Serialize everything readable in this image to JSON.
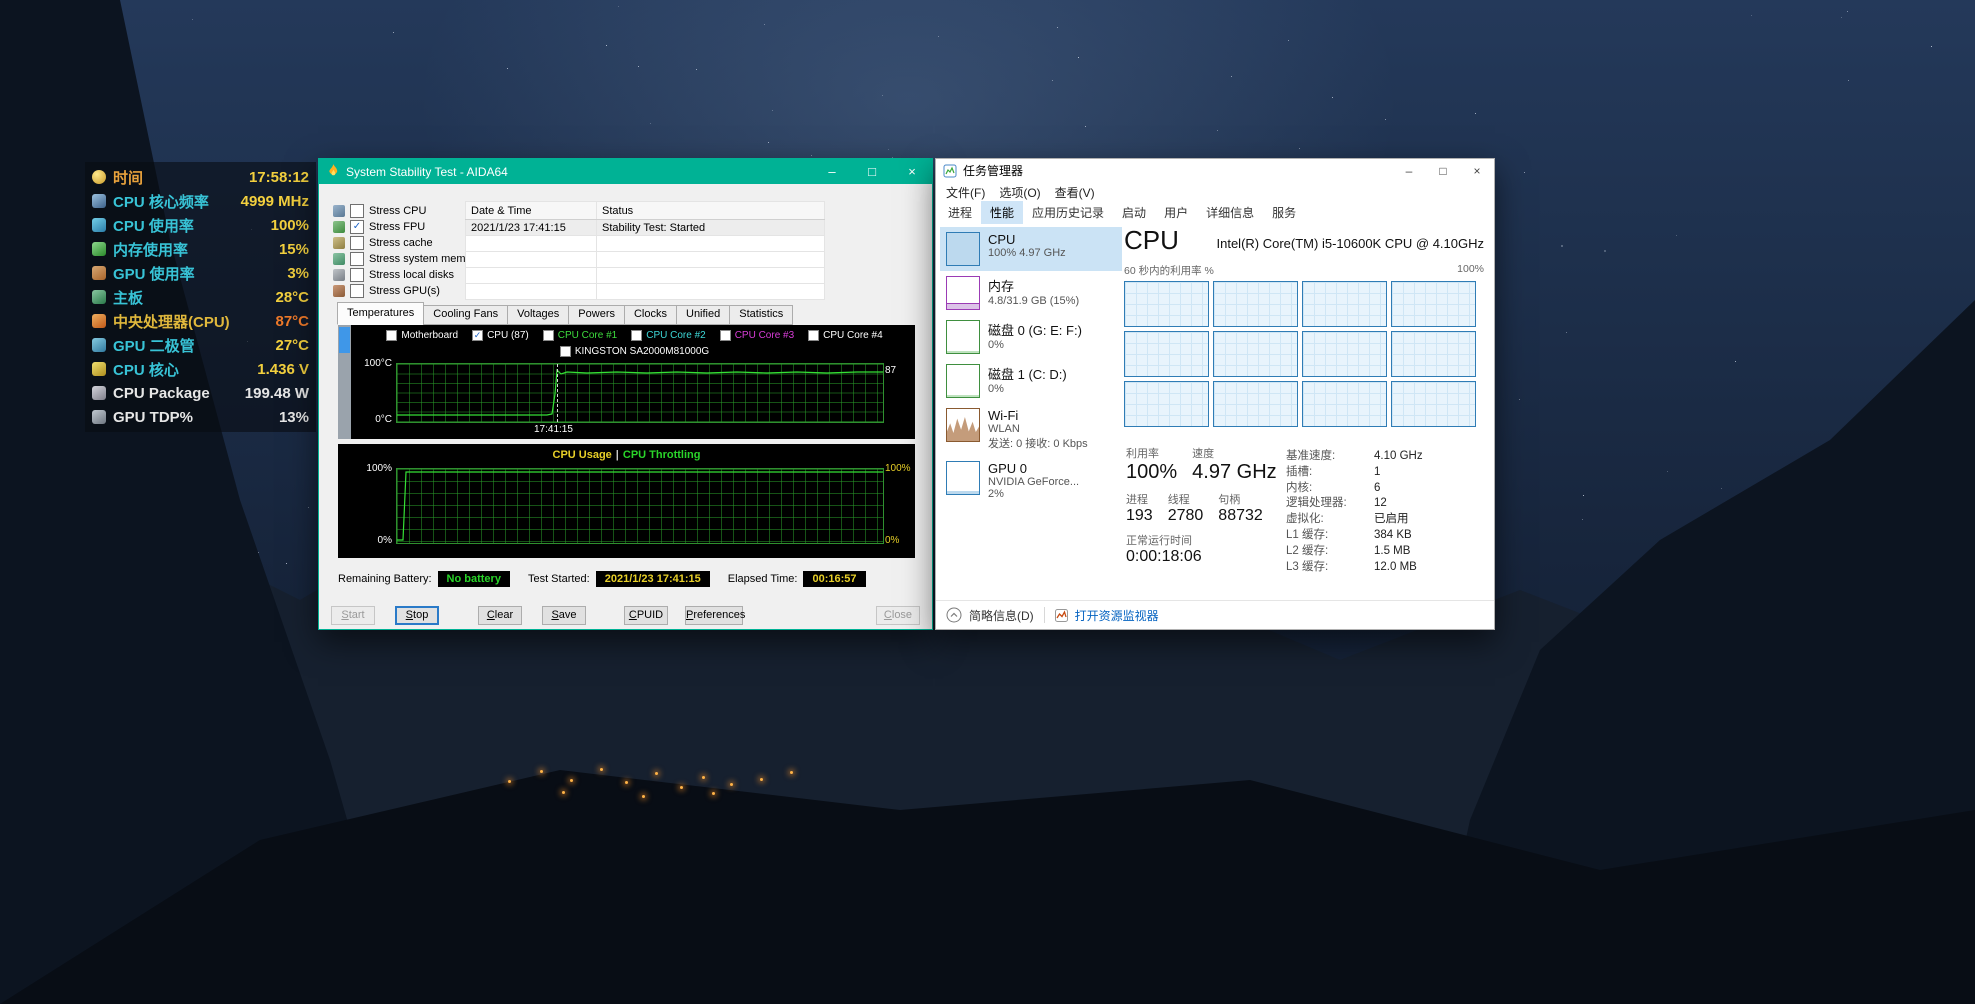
{
  "colors": {
    "sst_accent": "#00b295",
    "tm_chart_blue": "#2f7cb5",
    "chart_green": "#35e035",
    "chart_yellow": "#e8d028"
  },
  "sensor_panel": {
    "rows": [
      {
        "icon": "clock",
        "label": "时间",
        "value": "17:58:12",
        "label_color": "#e8a23c",
        "value_color": "#f3d03e"
      },
      {
        "icon": "frequency",
        "label": "CPU 核心频率",
        "value": "4999 MHz",
        "label_color": "#38c3d6",
        "value_color": "#f3d03e"
      },
      {
        "icon": "cpu-usage",
        "label": "CPU 使用率",
        "value": "100%",
        "label_color": "#38c3d6",
        "value_color": "#f3d03e"
      },
      {
        "icon": "memory",
        "label": "内存使用率",
        "value": "15%",
        "label_color": "#38c3d6",
        "value_color": "#f3d03e"
      },
      {
        "icon": "gpu",
        "label": "GPU 使用率",
        "value": "3%",
        "label_color": "#38c3d6",
        "value_color": "#f3d03e"
      },
      {
        "icon": "motherboard",
        "label": "主板",
        "value": "28°C",
        "label_color": "#38c3d6",
        "value_color": "#f3d03e"
      },
      {
        "icon": "cpu-temp",
        "label": "中央处理器(CPU)",
        "value": "87°C",
        "label_color": "#e0b83c",
        "value_color": "#ef7a2a"
      },
      {
        "icon": "gpu-temp",
        "label": "GPU 二极管",
        "value": "27°C",
        "label_color": "#38c3d6",
        "value_color": "#f3d03e"
      },
      {
        "icon": "voltage",
        "label": "CPU 核心",
        "value": "1.436 V",
        "label_color": "#38c3d6",
        "value_color": "#f3d03e"
      },
      {
        "icon": "power",
        "label": "CPU Package",
        "value": "199.48 W",
        "label_color": "#e6e6e6",
        "value_color": "#e6e6e6"
      },
      {
        "icon": "tdp",
        "label": "GPU TDP%",
        "value": "13%",
        "label_color": "#e6e6e6",
        "value_color": "#e6e6e6"
      }
    ]
  },
  "stability_test": {
    "title": "System Stability Test - AIDA64",
    "window_controls": [
      "–",
      "□",
      "×"
    ],
    "stress_options": [
      {
        "label": "Stress CPU",
        "checked": false
      },
      {
        "label": "Stress FPU",
        "checked": true
      },
      {
        "label": "Stress cache",
        "checked": false
      },
      {
        "label": "Stress system memory",
        "checked": false
      },
      {
        "label": "Stress local disks",
        "checked": false
      },
      {
        "label": "Stress GPU(s)",
        "checked": false
      }
    ],
    "log": {
      "headers": [
        "Date & Time",
        "Status"
      ],
      "rows": [
        [
          "2021/1/23 17:41:15",
          "Stability Test: Started"
        ]
      ]
    },
    "tabs": [
      "Temperatures",
      "Cooling Fans",
      "Voltages",
      "Powers",
      "Clocks",
      "Unified",
      "Statistics"
    ],
    "active_tab": "Temperatures",
    "legend": [
      {
        "label": "Motherboard",
        "checked": false,
        "color": "#ffffff"
      },
      {
        "label": "CPU (87)",
        "checked": true,
        "color": "#ffffff"
      },
      {
        "label": "CPU Core #1",
        "checked": false,
        "color": "#3ddb3d"
      },
      {
        "label": "CPU Core #2",
        "checked": false,
        "color": "#3dd8d8"
      },
      {
        "label": "CPU Core #3",
        "checked": false,
        "color": "#d83dd8"
      },
      {
        "label": "CPU Core #4",
        "checked": false,
        "color": "#ffffff"
      },
      {
        "label": "KINGSTON SA2000M81000G",
        "checked": false,
        "color": "#ffffff"
      }
    ],
    "temp_chart": {
      "y_top": "100°C",
      "y_bottom": "0°C",
      "time_marker": "17:41:15",
      "value_label": "87"
    },
    "usage_chart": {
      "title_left": "CPU Usage",
      "title_right": "CPU Throttling",
      "y_top": "100%",
      "y_bottom": "0%",
      "right_top": "100%",
      "right_bottom": "0%"
    },
    "footer": {
      "battery_label": "Remaining Battery:",
      "battery_value": "No battery",
      "started_label": "Test Started:",
      "started_value": "2021/1/23 17:41:15",
      "elapsed_label": "Elapsed Time:",
      "elapsed_value": "00:16:57"
    },
    "buttons": [
      {
        "label": "Start",
        "enabled": false
      },
      {
        "label": "Stop",
        "enabled": true,
        "default": true
      },
      {
        "label": "Clear",
        "enabled": true
      },
      {
        "label": "Save",
        "enabled": true
      },
      {
        "label": "CPUID",
        "enabled": true
      },
      {
        "label": "Preferences",
        "enabled": true
      },
      {
        "label": "Close",
        "enabled": false
      }
    ]
  },
  "task_manager": {
    "title": "任务管理器",
    "window_controls": [
      "–",
      "□",
      "×"
    ],
    "menu": [
      "文件(F)",
      "选项(O)",
      "查看(V)"
    ],
    "tabs": [
      "进程",
      "性能",
      "应用历史记录",
      "启动",
      "用户",
      "详细信息",
      "服务"
    ],
    "active_tab": "性能",
    "sidebar": [
      {
        "label": "CPU",
        "lines": [
          "100% 4.97 GHz"
        ],
        "thumb": "cpu",
        "selected": true
      },
      {
        "label": "内存",
        "lines": [
          "4.8/31.9 GB (15%)"
        ],
        "thumb": "memory",
        "selected": false
      },
      {
        "label": "磁盘 0 (G: E: F:)",
        "lines": [
          "0%"
        ],
        "thumb": "disk",
        "selected": false
      },
      {
        "label": "磁盘 1 (C: D:)",
        "lines": [
          "0%"
        ],
        "thumb": "disk",
        "selected": false
      },
      {
        "label": "Wi-Fi",
        "lines": [
          "WLAN",
          "发送: 0 接收: 0 Kbps"
        ],
        "thumb": "wifi",
        "selected": false
      },
      {
        "label": "GPU 0",
        "lines": [
          "NVIDIA GeForce...",
          "2%"
        ],
        "thumb": "gpu",
        "selected": false
      }
    ],
    "main": {
      "title": "CPU",
      "cpu_name": "Intel(R) Core(TM) i5-10600K CPU @ 4.10GHz",
      "graph_label": "60 秒内的利用率 %",
      "graph_max": "100%",
      "core_count": 12,
      "stats": {
        "util_label": "利用率",
        "util": "100%",
        "speed_label": "速度",
        "speed": "4.97 GHz",
        "proc_label": "进程",
        "proc": "193",
        "thread_label": "线程",
        "threads": "2780",
        "handle_label": "句柄",
        "handles": "88732",
        "uptime_label": "正常运行时间",
        "uptime": "0:00:18:06"
      },
      "details": [
        {
          "label": "基准速度:",
          "value": "4.10 GHz"
        },
        {
          "label": "插槽:",
          "value": "1"
        },
        {
          "label": "内核:",
          "value": "6"
        },
        {
          "label": "逻辑处理器:",
          "value": "12"
        },
        {
          "label": "虚拟化:",
          "value": "已启用"
        },
        {
          "label": "L1 缓存:",
          "value": "384 KB"
        },
        {
          "label": "L2 缓存:",
          "value": "1.5 MB"
        },
        {
          "label": "L3 缓存:",
          "value": "12.0 MB"
        }
      ]
    },
    "footer": {
      "collapse": "简略信息(D)",
      "resmon": "打开资源监视器"
    }
  }
}
